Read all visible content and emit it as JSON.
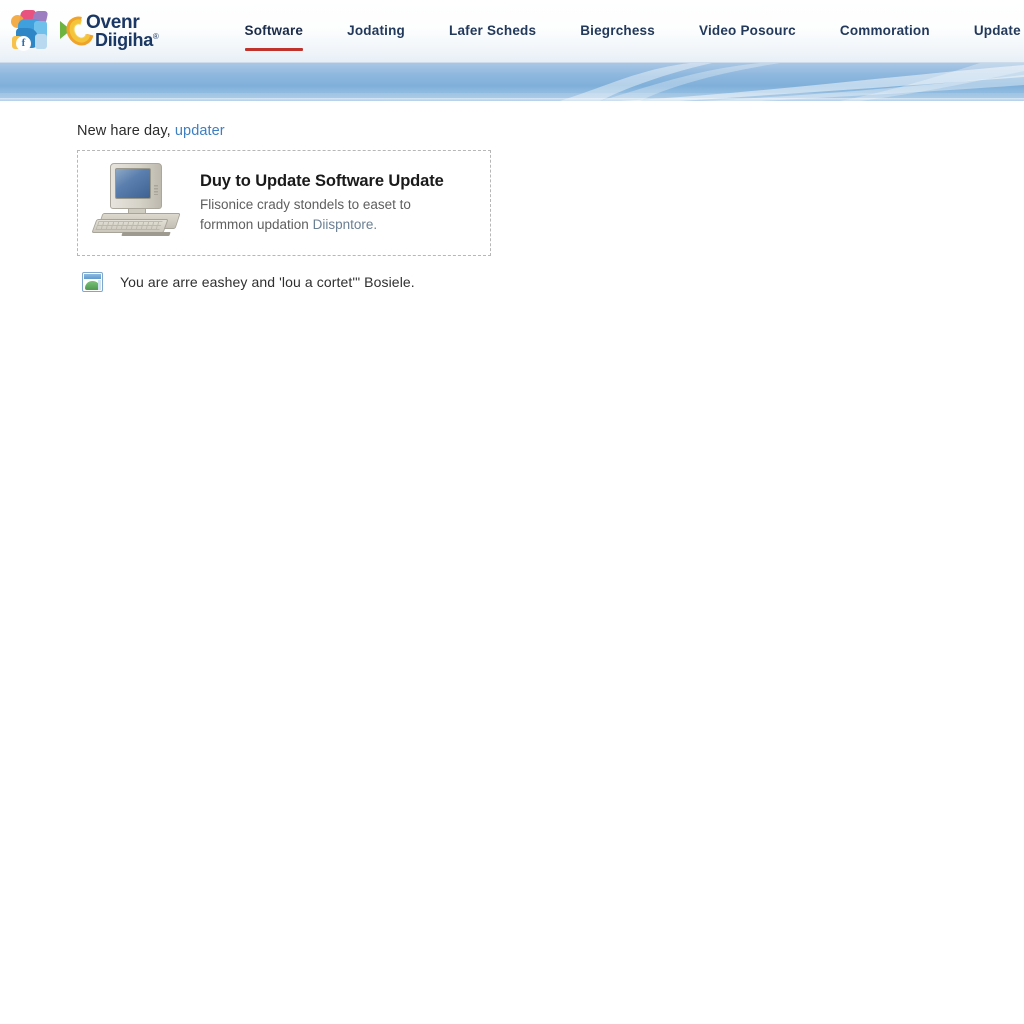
{
  "header": {
    "logo": {
      "badge_letter": "f",
      "line1": "Ovenr",
      "line2": "Diigiha",
      "trademark": "®"
    },
    "nav_items": [
      {
        "label": "Software",
        "active": true
      },
      {
        "label": "Jodating",
        "active": false
      },
      {
        "label": "Lafer Scheds",
        "active": false
      },
      {
        "label": "Biegrchess",
        "active": false
      },
      {
        "label": "Video Posourc",
        "active": false
      },
      {
        "label": "Commoration",
        "active": false
      },
      {
        "label": "Update",
        "active": false
      }
    ],
    "icons": [
      {
        "name": "hamburger-menu-icon"
      },
      {
        "name": "share-icon"
      },
      {
        "name": "bookmark-icon"
      }
    ],
    "accent_color": "#c0322c",
    "nav_text_color": "#23395c"
  },
  "banner": {
    "gradient_from": "#a9c7e4",
    "gradient_to": "#7fb0da",
    "wave_color": "#ffffff"
  },
  "main": {
    "greeting_prefix": "New hare day,",
    "greeting_link": "updater",
    "promo": {
      "image_alt": "retro-desktop-computer",
      "title": "Duy to Update Software Update",
      "description_line1": "Flisonice crady stondels to easet to",
      "description_line2": "formmon updation",
      "description_tail": "Diispntore."
    },
    "note": {
      "icon": "image-thumbnail-icon",
      "text": "You are arre eashey and 'lou a cortet'\" Bosiele."
    }
  },
  "colors": {
    "link_blue": "#3d7fc1",
    "body_gray": "#5e5e5e",
    "page_background": "#ffffff"
  }
}
